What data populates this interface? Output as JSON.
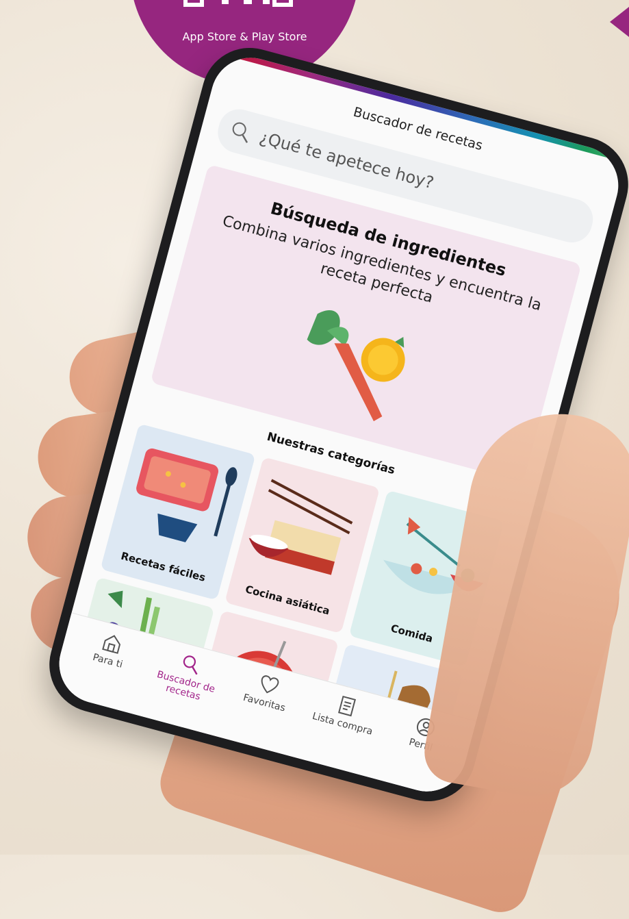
{
  "badge": {
    "store_text": "App Store & Play Store"
  },
  "app": {
    "title": "Buscador de recetas",
    "search": {
      "placeholder": "¿Qué te apetece hoy?"
    },
    "banner": {
      "heading": "Búsqueda de ingredientes",
      "subtitle": "Combina varios ingredientes y encuentra la receta perfecta"
    },
    "section_title": "Nuestras categorías",
    "categories": [
      {
        "label": "Recetas fáciles"
      },
      {
        "label": "Cocina asiática"
      },
      {
        "label": "Comida"
      },
      {
        "label": ""
      },
      {
        "label": ""
      },
      {
        "label": ""
      }
    ],
    "nav": [
      {
        "label": "Para ti",
        "icon": "home-icon"
      },
      {
        "label": "Buscador de recetas",
        "icon": "search-icon"
      },
      {
        "label": "Favoritas",
        "icon": "heart-icon"
      },
      {
        "label": "Lista compra",
        "icon": "list-icon"
      },
      {
        "label": "Perfil",
        "icon": "profile-icon"
      }
    ],
    "colors": {
      "accent": "#a2248a",
      "badge": "#96267f"
    }
  }
}
